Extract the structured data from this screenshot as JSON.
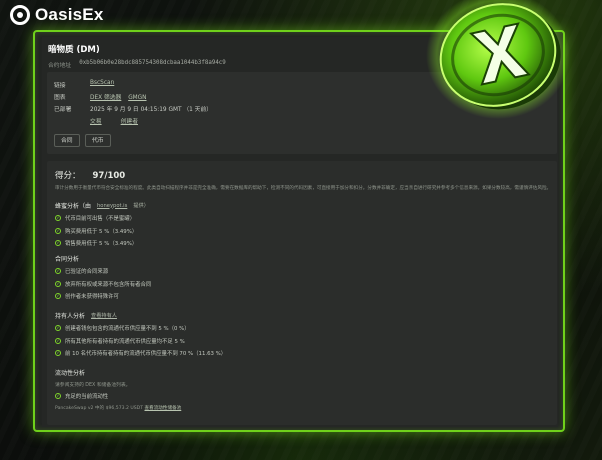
{
  "brand": {
    "name": "OasisEx",
    "accent": "#6fd11b"
  },
  "token": {
    "title": "暗物质 (DM)",
    "contract_label": "合约地址",
    "address": "0xb5b06b0e28bdc885754308dcbaa1044b3f8a94c9"
  },
  "info": {
    "chain_label": "链接",
    "chain_value": "BscScan",
    "chart_label": "图表",
    "chart_links": [
      "DEX 筛选器",
      "GMGN"
    ],
    "listed_label": "已部署",
    "listed_value": "2025 年 9 月 9 日 04:15:19 GMT （1 天前）",
    "sub_links": [
      "交易",
      "创建者"
    ],
    "buttons": [
      "合同",
      "代币"
    ]
  },
  "score": {
    "label": "得分：",
    "value": "97/100",
    "description": "审计分数用于衡量代币符合安全标准的程度。此类自动扫描程序并非是完全准确，需要在数据库的帮助下，检测不同的代码因素，可直接用于加分和扣分。分数并非确定，应当亲自进行研究并参考多个信息来源。如果分数较高，需谨慎评估风险。"
  },
  "honeypot": {
    "title": "蜂蜜分析（由",
    "link": "honeypot.is",
    "suffix": "提供）",
    "items": [
      "代币目前可出售（不是蜜罐）",
      "购买费用低于 5 %（3.49%）",
      "销售费用低于 5 %（3.49%）"
    ]
  },
  "contract": {
    "title": "合同分析",
    "items": [
      "已验证的合同来源",
      "放弃所有权或来源不包含所有者合同",
      "创作者未获得特殊许可"
    ]
  },
  "holders": {
    "title": "持有人分析",
    "link": "查看持有人",
    "items": [
      "创建者钱包包含的流通代币供应量不到 5 %（0 %）",
      "所有其他所有者持有的流通代币供应量均不足 5 %",
      "前 10 名代币持有者持有的流通代币供应量不到 70 %（11.63 %）"
    ]
  },
  "liquidity": {
    "title": "流动性分析",
    "note": "请参阅支持的 DEX 和储备池列表。",
    "items": [
      "充足的当前流动性"
    ],
    "footer": "PancakeSwap v2 中的 $96,573.2 USDT",
    "footer_link": "查看流动性储备池"
  }
}
